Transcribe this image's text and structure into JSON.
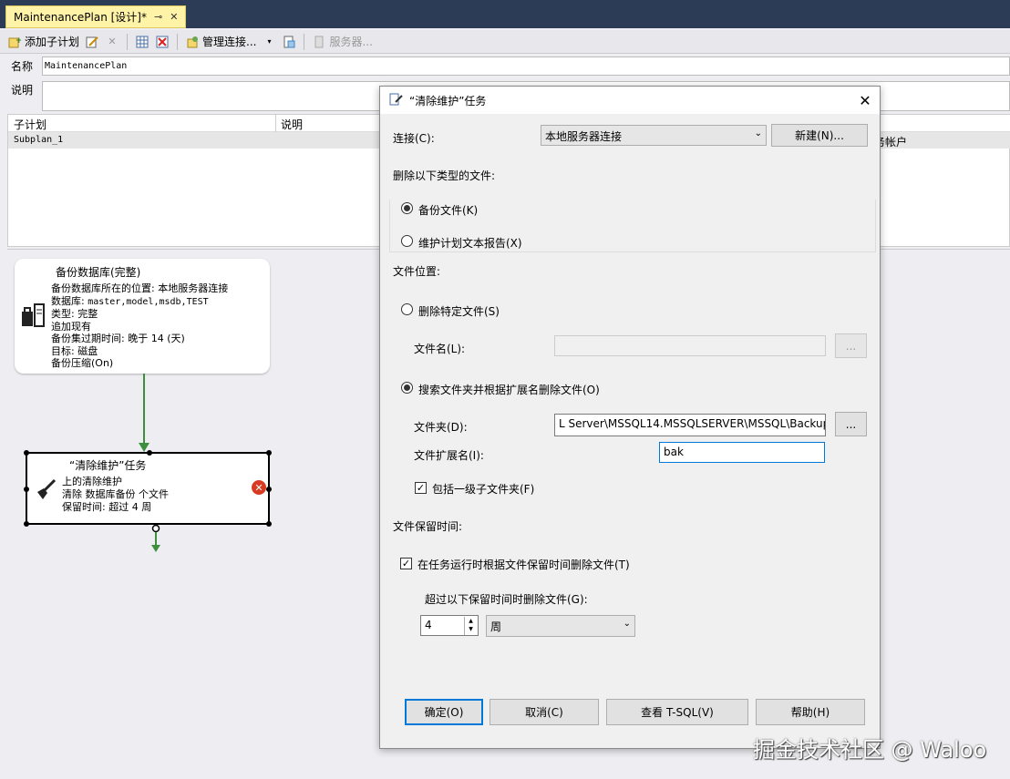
{
  "tab": {
    "title": "MaintenancePlan [设计]*",
    "pin": "⊸",
    "close": "✕"
  },
  "toolbar": {
    "add_subplan": "添加子计划",
    "manage_connections": "管理连接...",
    "servers": "服务器..."
  },
  "plan": {
    "name_label": "名称",
    "name_value": "MaintenancePlan",
    "desc_label": "说明"
  },
  "grid": {
    "col_subplan": "子计划",
    "col_desc": "说明",
    "col_account_partial": "务帐户",
    "rows": [
      {
        "subplan": "Subplan_1"
      }
    ]
  },
  "backup_card": {
    "title": "备份数据库(完整)",
    "line1": "备份数据库所在的位置: 本地服务器连接",
    "line2_label": "数据库: ",
    "line2_value": "master,model,msdb,TEST",
    "line3": "类型: 完整",
    "line4": "追加现有",
    "line5": "备份集过期时间: 晚于 14 (天)",
    "line6": "目标: 磁盘",
    "line7": "备份压缩(On)"
  },
  "cleanup_card": {
    "title": "“清除维护”任务",
    "line1": "上的清除维护",
    "line2": "清除 数据库备份 个文件",
    "line3": "保留时间: 超过 4 周"
  },
  "dialog": {
    "title": "“清除维护”任务",
    "connection_label": "连接(C):",
    "connection_value": "本地服务器连接",
    "new_button": "新建(N)...",
    "delete_types_label": "删除以下类型的文件:",
    "radio_backup": "备份文件(K)",
    "radio_report": "维护计划文本报告(X)",
    "file_location_label": "文件位置:",
    "radio_specific": "删除特定文件(S)",
    "filename_label": "文件名(L):",
    "filename_value": "",
    "browse_label": "...",
    "radio_search": "搜索文件夹并根据扩展名删除文件(O)",
    "folder_label": "文件夹(D):",
    "folder_value": "L Server\\MSSQL14.MSSQLSERVER\\MSSQL\\Backup",
    "ext_label": "文件扩展名(I):",
    "ext_value": "bak",
    "include_subfolders": "包括一级子文件夹(F)",
    "retention_label": "文件保留时间:",
    "delete_by_age": "在任务运行时根据文件保留时间删除文件(T)",
    "older_than_label": "超过以下保留时间时删除文件(G):",
    "age_value": "4",
    "age_unit": "周",
    "ok": "确定(O)",
    "cancel": "取消(C)",
    "view_tsql": "查看 T-SQL(V)",
    "help": "帮助(H)"
  },
  "watermark": "掘金技术社区 @ Waloo"
}
